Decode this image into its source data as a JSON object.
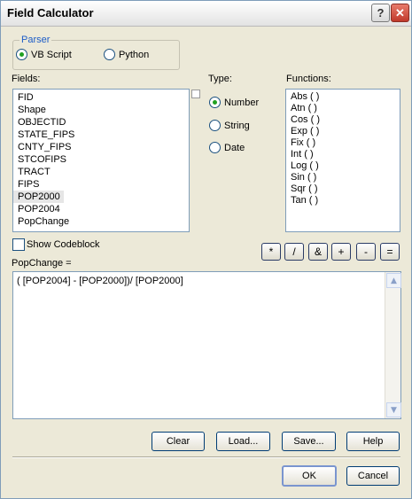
{
  "window": {
    "title": "Field Calculator",
    "help_glyph": "?",
    "close_glyph": "✕"
  },
  "parser": {
    "label": "Parser",
    "options": [
      {
        "label": "VB Script",
        "selected": true
      },
      {
        "label": "Python",
        "selected": false
      }
    ]
  },
  "fields": {
    "label": "Fields:",
    "items": [
      "FID",
      "Shape",
      "OBJECTID",
      "STATE_FIPS",
      "CNTY_FIPS",
      "STCOFIPS",
      "TRACT",
      "FIPS",
      "POP2000",
      "POP2004",
      "PopChange"
    ],
    "highlighted": "POP2000"
  },
  "type": {
    "label": "Type:",
    "options": [
      {
        "label": "Number",
        "selected": true
      },
      {
        "label": "String",
        "selected": false
      },
      {
        "label": "Date",
        "selected": false
      }
    ]
  },
  "functions": {
    "label": "Functions:",
    "items": [
      "Abs ( )",
      "Atn ( )",
      "Cos ( )",
      "Exp ( )",
      "Fix ( )",
      "Int ( )",
      "Log ( )",
      "Sin ( )",
      "Sqr ( )",
      "Tan ( )"
    ]
  },
  "codeblock": {
    "label": "Show Codeblock",
    "checked": false
  },
  "operators": [
    "*",
    "/",
    "&",
    "+",
    "-",
    "="
  ],
  "expression": {
    "label": "PopChange =",
    "value": "( [POP2004] - [POP2000])/ [POP2000]"
  },
  "buttons": {
    "clear": "Clear",
    "load": "Load...",
    "save": "Save...",
    "help": "Help",
    "ok": "OK",
    "cancel": "Cancel"
  },
  "colors": {
    "accent": "#1c5cc7",
    "radio_dot": "#21a121",
    "close": "#c0392b"
  },
  "icons": {
    "help": "question-mark-icon",
    "close": "close-icon",
    "scroll_up": "chevron-up-icon",
    "scroll_down": "chevron-down-icon"
  }
}
